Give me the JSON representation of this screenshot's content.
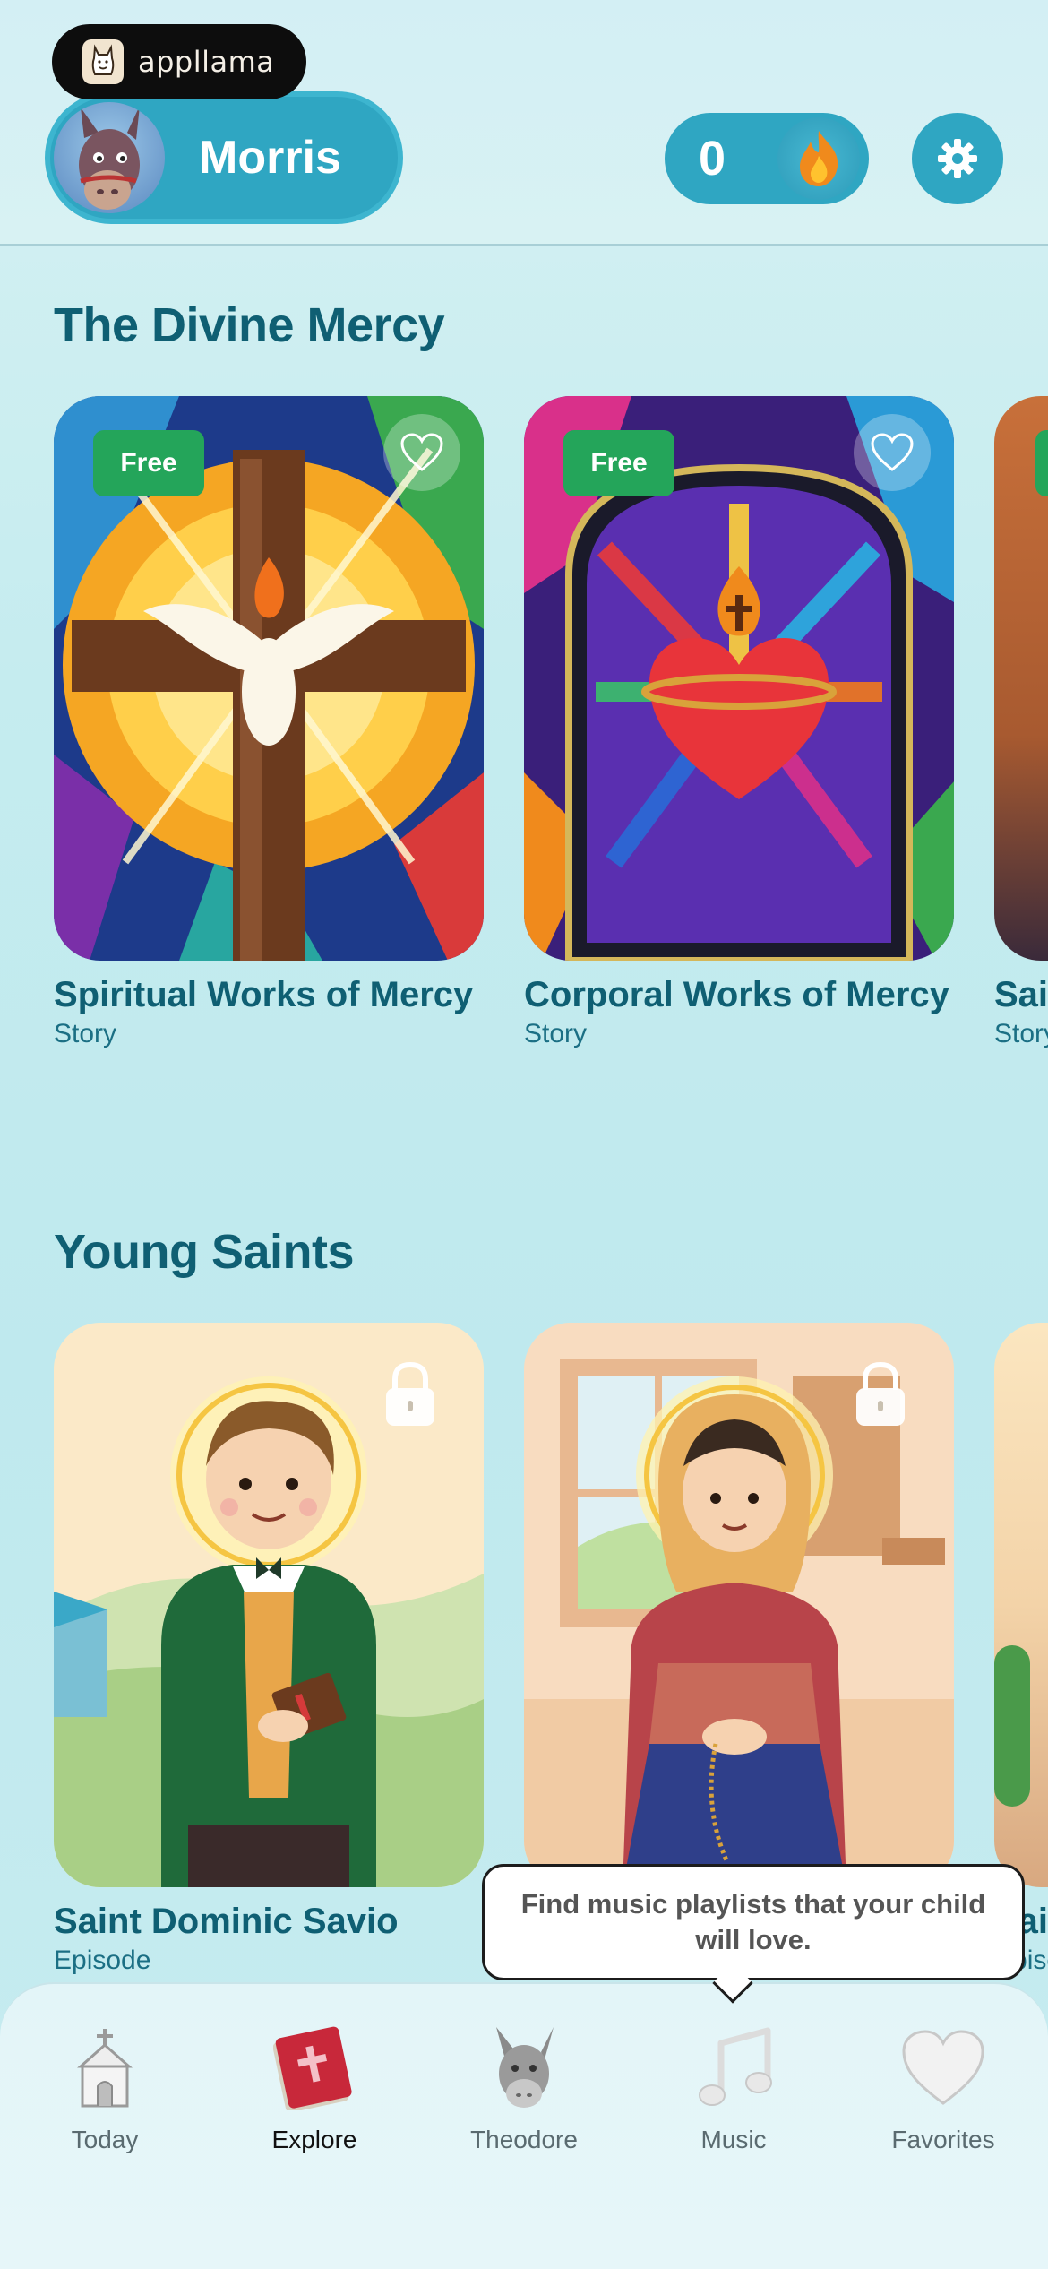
{
  "header": {
    "brand_name": "appllama",
    "profile_name": "Morris",
    "streak_count": "0",
    "icons": {
      "brand": "llama-logo-icon",
      "avatar": "donkey-avatar",
      "streak": "flame-icon",
      "settings": "gear-icon"
    }
  },
  "sections": [
    {
      "title": "The Divine Mercy",
      "cards": [
        {
          "title": "Spiritual Works of Mercy",
          "type": "Story",
          "badge": "Free",
          "icon": "heart-outline-icon"
        },
        {
          "title": "Corporal Works of Mercy",
          "type": "Story",
          "badge": "Free",
          "icon": "heart-outline-icon"
        },
        {
          "title": "Sai",
          "type": "Story"
        }
      ]
    },
    {
      "title": "Young Saints",
      "cards": [
        {
          "title": "Saint Dominic Savio",
          "type": "Episode",
          "icon": "lock-icon"
        },
        {
          "title": "",
          "type": "",
          "icon": "lock-icon"
        },
        {
          "title": "Sai",
          "type": "Episo"
        }
      ]
    }
  ],
  "tooltip": {
    "text": "Find music playlists that your child will love."
  },
  "tabbar": {
    "tabs": [
      {
        "label": "Today",
        "icon": "church-icon"
      },
      {
        "label": "Explore",
        "icon": "book-icon",
        "active": true
      },
      {
        "label": "Theodore",
        "icon": "donkey-icon"
      },
      {
        "label": "Music",
        "icon": "music-note-icon"
      },
      {
        "label": "Favorites",
        "icon": "heart-icon"
      }
    ]
  },
  "colors": {
    "accent": "#2fa6c2",
    "title": "#0f5f73",
    "free_badge": "#24a55a"
  }
}
